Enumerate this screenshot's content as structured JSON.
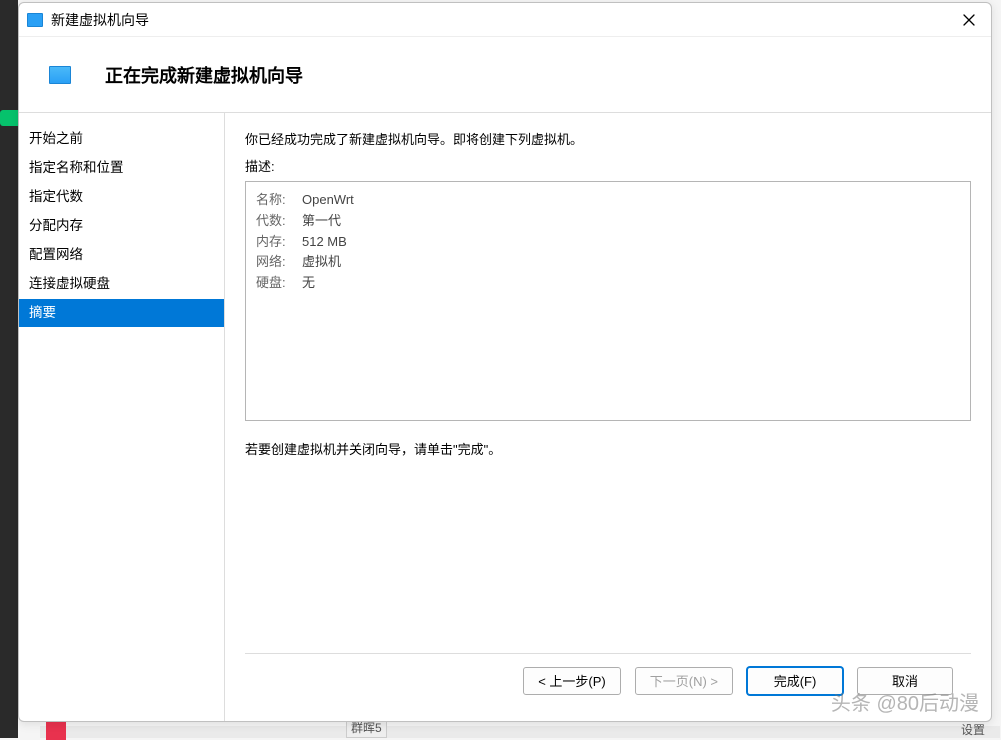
{
  "window": {
    "title": "新建虚拟机向导"
  },
  "header": {
    "title": "正在完成新建虚拟机向导"
  },
  "sidebar": {
    "steps": [
      "开始之前",
      "指定名称和位置",
      "指定代数",
      "分配内存",
      "配置网络",
      "连接虚拟硬盘",
      "摘要"
    ]
  },
  "content": {
    "intro": "你已经成功完成了新建虚拟机向导。即将创建下列虚拟机。",
    "desc_label": "描述:",
    "summary": {
      "name_k": "名称:",
      "name_v": "OpenWrt",
      "gen_k": "代数:",
      "gen_v": "第一代",
      "mem_k": "内存:",
      "mem_v": "512 MB",
      "net_k": "网络:",
      "net_v": "虚拟机",
      "disk_k": "硬盘:",
      "disk_v": "无"
    },
    "hint": "若要创建虚拟机并关闭向导，请单击\"完成\"。"
  },
  "footer": {
    "back": "< 上一步(P)",
    "next": "下一页(N) >",
    "finish": "完成(F)",
    "cancel": "取消"
  },
  "watermark": "头条 @80后动漫",
  "bg": {
    "frag2": "群晖5",
    "frag3": "设置"
  }
}
